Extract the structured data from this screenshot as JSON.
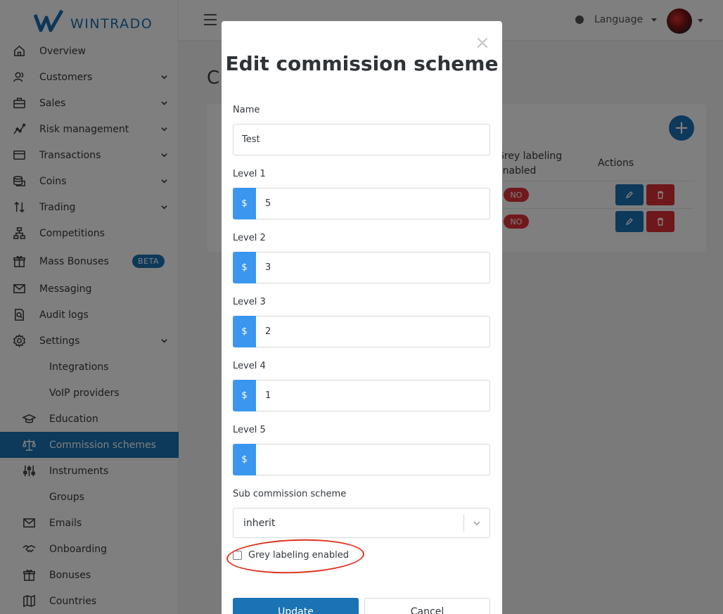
{
  "app": {
    "brand": "WINTRADO"
  },
  "sidebar": {
    "items": [
      {
        "label": "Overview",
        "icon": "home-icon"
      },
      {
        "label": "Customers",
        "icon": "users-icon",
        "has_submenu": true
      },
      {
        "label": "Sales",
        "icon": "briefcase-icon",
        "has_submenu": true
      },
      {
        "label": "Risk management",
        "icon": "chart-line-icon",
        "has_submenu": true
      },
      {
        "label": "Transactions",
        "icon": "credit-card-icon",
        "has_submenu": true
      },
      {
        "label": "Coins",
        "icon": "coins-icon",
        "has_submenu": true
      },
      {
        "label": "Trading",
        "icon": "arrows-updown-icon",
        "has_submenu": true
      },
      {
        "label": "Competitions",
        "icon": "sitemap-icon"
      },
      {
        "label": "Mass Bonuses",
        "icon": "gift-icon",
        "badge": "BETA"
      },
      {
        "label": "Messaging",
        "icon": "envelope-icon"
      },
      {
        "label": "Audit logs",
        "icon": "file-search-icon"
      },
      {
        "label": "Settings",
        "icon": "gear-icon",
        "has_submenu": true
      },
      {
        "label": "Integrations"
      },
      {
        "label": "VoIP providers"
      },
      {
        "label": "Education",
        "icon": "graduation-cap-icon"
      },
      {
        "label": "Commission schemes",
        "icon": "scale-icon",
        "active": true
      },
      {
        "label": "Instruments",
        "icon": "sliders-icon"
      },
      {
        "label": "Groups"
      },
      {
        "label": "Emails",
        "icon": "envelope-icon"
      },
      {
        "label": "Onboarding",
        "icon": "handshake-icon"
      },
      {
        "label": "Bonuses",
        "icon": "gift-icon"
      },
      {
        "label": "Countries",
        "icon": "map-icon"
      }
    ]
  },
  "topbar": {
    "language_label": "Language"
  },
  "page": {
    "title_partial": "C",
    "table": {
      "headers": {
        "grey_labeling": "Grey labeling enabled",
        "actions": "Actions"
      },
      "rows": [
        {
          "grey_labeling": "NO"
        },
        {
          "grey_labeling": "NO"
        }
      ]
    },
    "add_button": "+"
  },
  "modal": {
    "close": "×",
    "title": "Edit commission scheme",
    "name_label": "Name",
    "name_value": "Test",
    "currency_symbol": "$",
    "levels": [
      {
        "label": "Level 1",
        "value": "5"
      },
      {
        "label": "Level 2",
        "value": "3"
      },
      {
        "label": "Level 3",
        "value": "2"
      },
      {
        "label": "Level 4",
        "value": "1"
      },
      {
        "label": "Level 5",
        "value": ""
      }
    ],
    "sub_scheme_label": "Sub commission scheme",
    "sub_scheme_value": "inherit",
    "grey_labeling_label": "Grey labeling enabled",
    "grey_labeling_checked": false,
    "update_button": "Update",
    "cancel_button": "Cancel"
  },
  "colors": {
    "primary": "#1a73b5",
    "addon": "#3b96f0",
    "danger": "#dc3038",
    "annotation": "#e0321e"
  }
}
